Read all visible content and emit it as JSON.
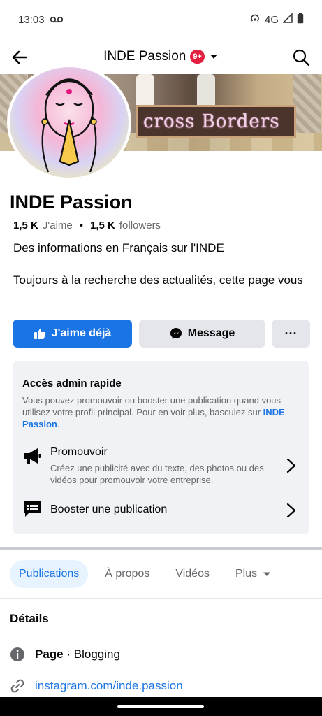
{
  "status_bar": {
    "time": "13:03",
    "network": "4G"
  },
  "app_bar": {
    "title": "INDE Passion",
    "badge": "9+"
  },
  "cover": {
    "text": "cross Borders"
  },
  "page": {
    "name": "INDE Passion",
    "likes_count": "1,5 K",
    "likes_label": "J'aime",
    "separator": "•",
    "followers_count": "1,5 K",
    "followers_label": "followers",
    "description": "Des informations en Français sur l'INDE",
    "tagline": "Toujours à la recherche des actualités, cette page vous"
  },
  "buttons": {
    "like": "J'aime déjà",
    "message": "Message",
    "more": "···"
  },
  "admin": {
    "title": "Accès admin rapide",
    "text": "Vous pouvez promouvoir ou booster une publication quand vous utilisez votre profil principal. Pour en voir plus, basculez sur ",
    "link": "INDE Passion",
    "text_end": ".",
    "items": [
      {
        "title": "Promouvoir",
        "subtitle": "Créez une publicité avec du texte, des photos ou des vidéos pour promouvoir votre entreprise."
      },
      {
        "title": "Booster une publication",
        "subtitle": ""
      }
    ]
  },
  "tabs": [
    {
      "label": "Publications",
      "active": true
    },
    {
      "label": "À propos"
    },
    {
      "label": "Vidéos"
    },
    {
      "label": "Plus"
    }
  ],
  "details": {
    "title": "Détails",
    "page_label": "Page",
    "page_category": " · Blogging",
    "link": "instagram.com/inde.passion"
  },
  "colors": {
    "accent": "#1b74e4",
    "badge": "#e41e3f",
    "card_bg": "#f0f2f5"
  }
}
